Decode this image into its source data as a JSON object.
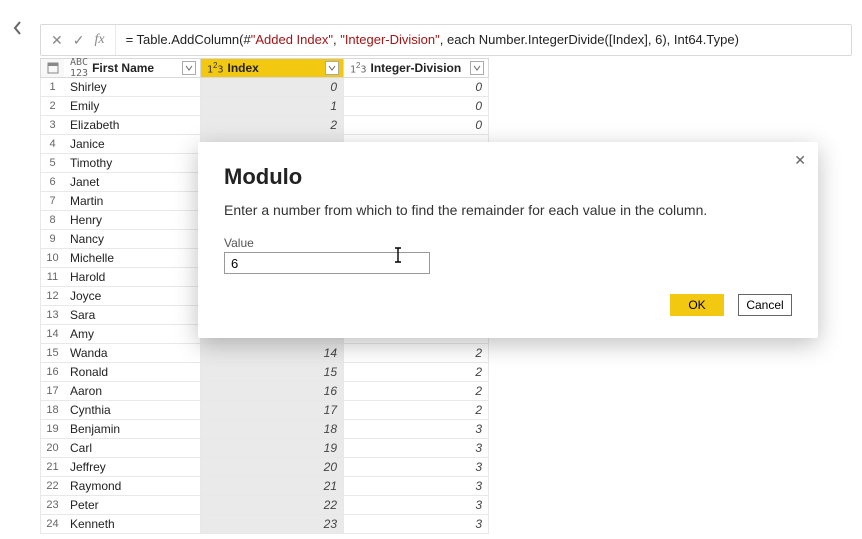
{
  "nav": {
    "back_icon": "chevron-left"
  },
  "formula_bar": {
    "cancel_icon": "x",
    "accept_icon": "check",
    "fx_icon": "fx",
    "prefix": "= Table.AddColumn(#",
    "str1": "\"Added Index\"",
    "mid1": ", ",
    "str2": "\"Integer-Division\"",
    "mid2": ", each ",
    "func": "Number.IntegerDivide([Index], 6), Int64.Type)"
  },
  "columns": [
    {
      "type": "ABC123",
      "label": "First Name",
      "key": "first_name",
      "class": "col-firstname"
    },
    {
      "type": "123",
      "label": "Index",
      "key": "index",
      "class": "col-index",
      "active": true
    },
    {
      "type": "123",
      "label": "Integer-Division",
      "key": "intdiv",
      "class": "col-intdiv"
    }
  ],
  "rows": [
    {
      "n": 1,
      "first_name": "Shirley",
      "index": 0,
      "intdiv": 0
    },
    {
      "n": 2,
      "first_name": "Emily",
      "index": 1,
      "intdiv": 0
    },
    {
      "n": 3,
      "first_name": "Elizabeth",
      "index": 2,
      "intdiv": 0
    },
    {
      "n": 4,
      "first_name": "Janice",
      "index": null,
      "intdiv": null
    },
    {
      "n": 5,
      "first_name": "Timothy",
      "index": null,
      "intdiv": null
    },
    {
      "n": 6,
      "first_name": "Janet",
      "index": null,
      "intdiv": null
    },
    {
      "n": 7,
      "first_name": "Martin",
      "index": null,
      "intdiv": null
    },
    {
      "n": 8,
      "first_name": "Henry",
      "index": null,
      "intdiv": null
    },
    {
      "n": 9,
      "first_name": "Nancy",
      "index": null,
      "intdiv": null
    },
    {
      "n": 10,
      "first_name": "Michelle",
      "index": null,
      "intdiv": null
    },
    {
      "n": 11,
      "first_name": "Harold",
      "index": null,
      "intdiv": null
    },
    {
      "n": 12,
      "first_name": "Joyce",
      "index": null,
      "intdiv": null
    },
    {
      "n": 13,
      "first_name": "Sara",
      "index": null,
      "intdiv": null
    },
    {
      "n": 14,
      "first_name": "Amy",
      "index": null,
      "intdiv": null
    },
    {
      "n": 15,
      "first_name": "Wanda",
      "index": 14,
      "intdiv": 2
    },
    {
      "n": 16,
      "first_name": "Ronald",
      "index": 15,
      "intdiv": 2
    },
    {
      "n": 17,
      "first_name": "Aaron",
      "index": 16,
      "intdiv": 2
    },
    {
      "n": 18,
      "first_name": "Cynthia",
      "index": 17,
      "intdiv": 2
    },
    {
      "n": 19,
      "first_name": "Benjamin",
      "index": 18,
      "intdiv": 3
    },
    {
      "n": 20,
      "first_name": "Carl",
      "index": 19,
      "intdiv": 3
    },
    {
      "n": 21,
      "first_name": "Jeffrey",
      "index": 20,
      "intdiv": 3
    },
    {
      "n": 22,
      "first_name": "Raymond",
      "index": 21,
      "intdiv": 3
    },
    {
      "n": 23,
      "first_name": "Peter",
      "index": 22,
      "intdiv": 3
    },
    {
      "n": 24,
      "first_name": "Kenneth",
      "index": 23,
      "intdiv": 3
    }
  ],
  "dialog": {
    "title": "Modulo",
    "description": "Enter a number from which to find the remainder for each value in the column.",
    "value_label": "Value",
    "value": "6",
    "ok_label": "OK",
    "cancel_label": "Cancel"
  }
}
